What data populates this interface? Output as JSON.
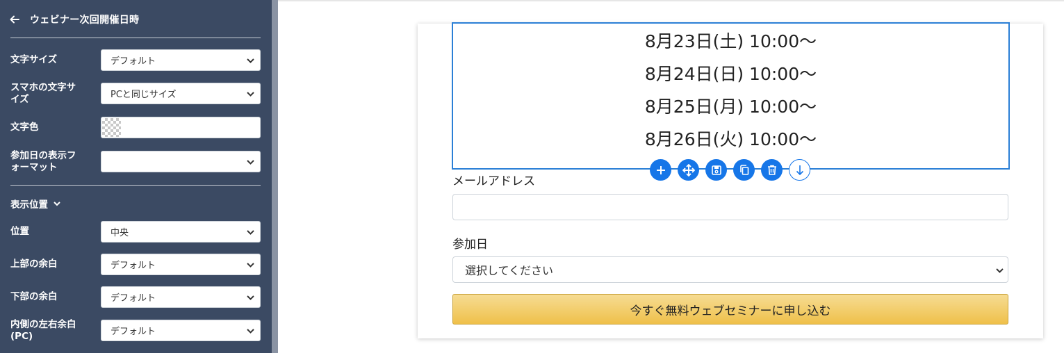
{
  "sidebar": {
    "title": "ウェビナー次回開催日時",
    "rows": [
      {
        "label": "文字サイズ",
        "value": "デフォルト"
      },
      {
        "label": "スマホの文字サイズ",
        "value": "PCと同じサイズ"
      },
      {
        "label": "文字色",
        "value": ""
      },
      {
        "label": "参加日の表示フォーマット",
        "value": ""
      },
      {
        "label": "位置",
        "value": "中央"
      },
      {
        "label": "上部の余白",
        "value": "デフォルト"
      },
      {
        "label": "下部の余白",
        "value": "デフォルト"
      },
      {
        "label": "内側の左右余白(PC)",
        "value": "デフォルト"
      }
    ],
    "section_label": "表示位置"
  },
  "canvas": {
    "dates": [
      "8月23日(土) 10:00〜",
      "8月24日(日) 10:00〜",
      "8月25日(月) 10:00〜",
      "8月26日(火) 10:00〜"
    ],
    "toolbar_icons": [
      "plus-icon",
      "move-icon",
      "save-icon",
      "copy-icon",
      "trash-icon",
      "arrow-down-icon"
    ],
    "email_label": "メールアドレス",
    "email_value": "",
    "date_label": "参加日",
    "date_select": "選択してください",
    "submit_label": "今すぐ無料ウェブセミナーに申し込む"
  },
  "colors": {
    "sidebar_bg": "#3b4a63",
    "accent": "#1676e8",
    "cta": "#efc04a"
  }
}
